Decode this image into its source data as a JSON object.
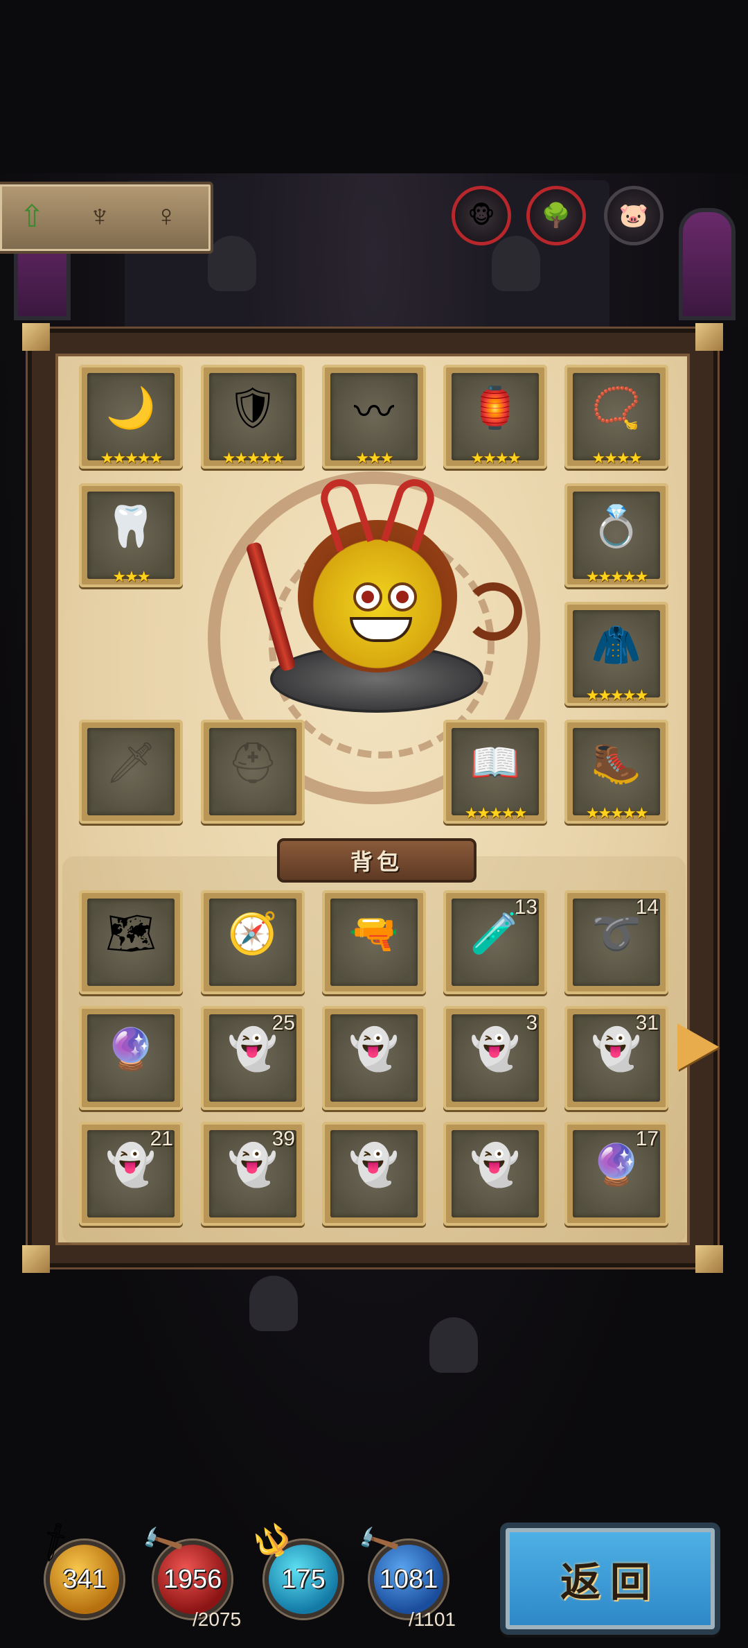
{
  "header": {
    "status_icons": [
      "arrow-up-icon",
      "candelabra-icon",
      "sleeping-figure-icon"
    ],
    "buffs": [
      {
        "icon": "monkey-face-icon",
        "state": "active"
      },
      {
        "icon": "tree-monster-icon",
        "state": "active"
      },
      {
        "icon": "pig-icon",
        "state": "inactive"
      }
    ]
  },
  "equipment": {
    "slots": [
      {
        "id": "ring",
        "icon": "crescent-ring-icon",
        "glyph": "🌙",
        "stars": "★★★★★"
      },
      {
        "id": "armor",
        "icon": "armor-icon",
        "glyph": "🛡",
        "stars": "★★★★★"
      },
      {
        "id": "bracelet",
        "icon": "gold-bracelet-icon",
        "glyph": "〰",
        "stars": "★★★"
      },
      {
        "id": "lantern",
        "icon": "lantern-icon",
        "glyph": "🏮",
        "stars": "★★★★"
      },
      {
        "id": "amulet",
        "icon": "amulet-icon",
        "glyph": "📿",
        "stars": "★★★★"
      },
      {
        "id": "belt",
        "icon": "fang-belt-icon",
        "glyph": "🦷",
        "stars": "★★★"
      },
      {
        "id": "gem-ring",
        "icon": "gem-ring-icon",
        "glyph": "💍",
        "stars": "★★★★★"
      },
      {
        "id": "cloak",
        "icon": "cloak-icon",
        "glyph": "🧥",
        "stars": "★★★★★"
      },
      {
        "id": "weapon",
        "icon": "sword-icon",
        "glyph": "🗡",
        "stars": ""
      },
      {
        "id": "helmet",
        "icon": "helmet-icon",
        "glyph": "⛑",
        "stars": ""
      },
      {
        "id": "book",
        "icon": "spellbook-icon",
        "glyph": "📖",
        "stars": "★★★★★"
      },
      {
        "id": "boots",
        "icon": "boots-icon",
        "glyph": "🥾",
        "stars": "★★★★★"
      }
    ]
  },
  "hero": {
    "icon": "monkey-king-gumball-icon"
  },
  "backpack": {
    "title": "背包",
    "items": [
      {
        "icon": "treasure-map-icon",
        "glyph": "🗺",
        "count": ""
      },
      {
        "icon": "compass-icon",
        "glyph": "🧭",
        "count": ""
      },
      {
        "icon": "pistol-icon",
        "glyph": "🔫",
        "count": ""
      },
      {
        "icon": "potion-vial-icon",
        "glyph": "🧪",
        "count": "13"
      },
      {
        "icon": "rope-icon",
        "glyph": "➰",
        "count": "14"
      },
      {
        "icon": "red-orb-icon",
        "glyph": "🔮",
        "count": ""
      },
      {
        "icon": "ghost-icon",
        "glyph": "👻",
        "count": "25"
      },
      {
        "icon": "ghost-icon",
        "glyph": "👻",
        "count": ""
      },
      {
        "icon": "ghost-icon",
        "glyph": "👻",
        "count": "3"
      },
      {
        "icon": "ghost-icon",
        "glyph": "👻",
        "count": "31"
      },
      {
        "icon": "ghost-icon",
        "glyph": "👻",
        "count": "21"
      },
      {
        "icon": "ghost-icon",
        "glyph": "👻",
        "count": "39"
      },
      {
        "icon": "ghost-icon",
        "glyph": "👻",
        "count": ""
      },
      {
        "icon": "ghost-icon",
        "glyph": "👻",
        "count": ""
      },
      {
        "icon": "red-orb-icon",
        "glyph": "🔮",
        "count": "17"
      }
    ]
  },
  "resources": {
    "gold": {
      "value": "341",
      "icon": "sword-icon"
    },
    "hp": {
      "value": "1956",
      "max": "/2075",
      "icon": "hammer-icon"
    },
    "mana": {
      "value": "175",
      "icon": "staff-icon"
    },
    "energy": {
      "value": "1081",
      "max": "/1101",
      "icon": "hammer-icon"
    }
  },
  "buttons": {
    "return_label": "返回"
  }
}
